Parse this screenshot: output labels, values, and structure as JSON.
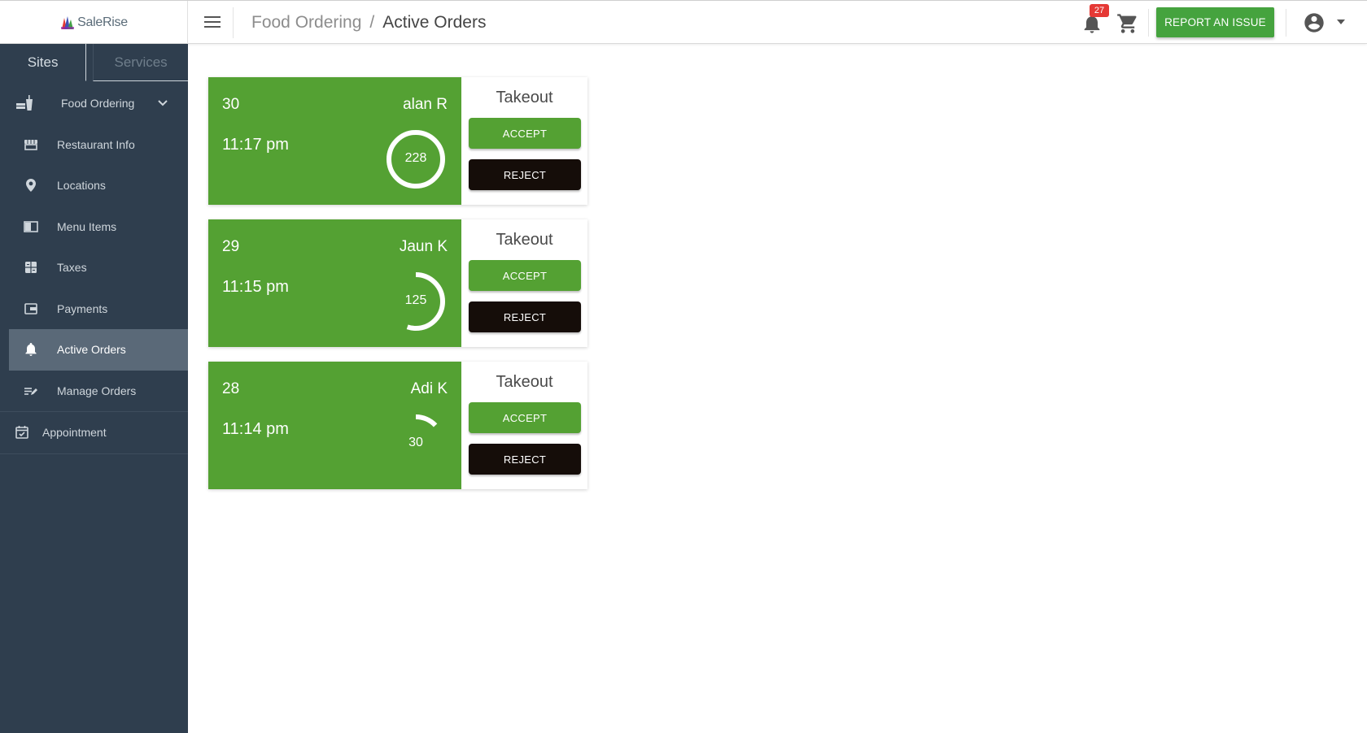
{
  "header": {
    "logo_text": "SaleRise",
    "breadcrumb": {
      "parent": "Food Ordering",
      "separator": "/",
      "current": "Active Orders"
    },
    "notification_count": "27",
    "report_button": "REPORT AN ISSUE"
  },
  "sidebar": {
    "tabs": [
      {
        "label": "Sites"
      },
      {
        "label": "Services"
      }
    ],
    "parent_item": "Food Ordering",
    "items": [
      {
        "label": "Restaurant Info",
        "icon": "storefront-icon"
      },
      {
        "label": "Locations",
        "icon": "location-pin-icon"
      },
      {
        "label": "Menu Items",
        "icon": "menu-book-icon"
      },
      {
        "label": "Taxes",
        "icon": "calculator-icon"
      },
      {
        "label": "Payments",
        "icon": "wallet-icon"
      },
      {
        "label": "Active Orders",
        "icon": "bell-icon"
      },
      {
        "label": "Manage Orders",
        "icon": "edit-list-icon"
      }
    ],
    "appointment": "Appointment"
  },
  "orders": [
    {
      "number": "30",
      "customer": "alan R",
      "time": "11:17 pm",
      "timer": "228",
      "progress": 1.0,
      "type": "Takeout",
      "accept": "ACCEPT",
      "reject": "REJECT"
    },
    {
      "number": "29",
      "customer": "Jaun K",
      "time": "11:15 pm",
      "timer": "125",
      "progress": 0.55,
      "type": "Takeout",
      "accept": "ACCEPT",
      "reject": "REJECT"
    },
    {
      "number": "28",
      "customer": "Adi K",
      "time": "11:14 pm",
      "timer": "30",
      "progress": 0.13,
      "type": "Takeout",
      "accept": "ACCEPT",
      "reject": "REJECT"
    }
  ],
  "colors": {
    "accent_green": "#54a133",
    "sidebar_bg": "#2f3e4e",
    "badge_red": "#e53935"
  }
}
